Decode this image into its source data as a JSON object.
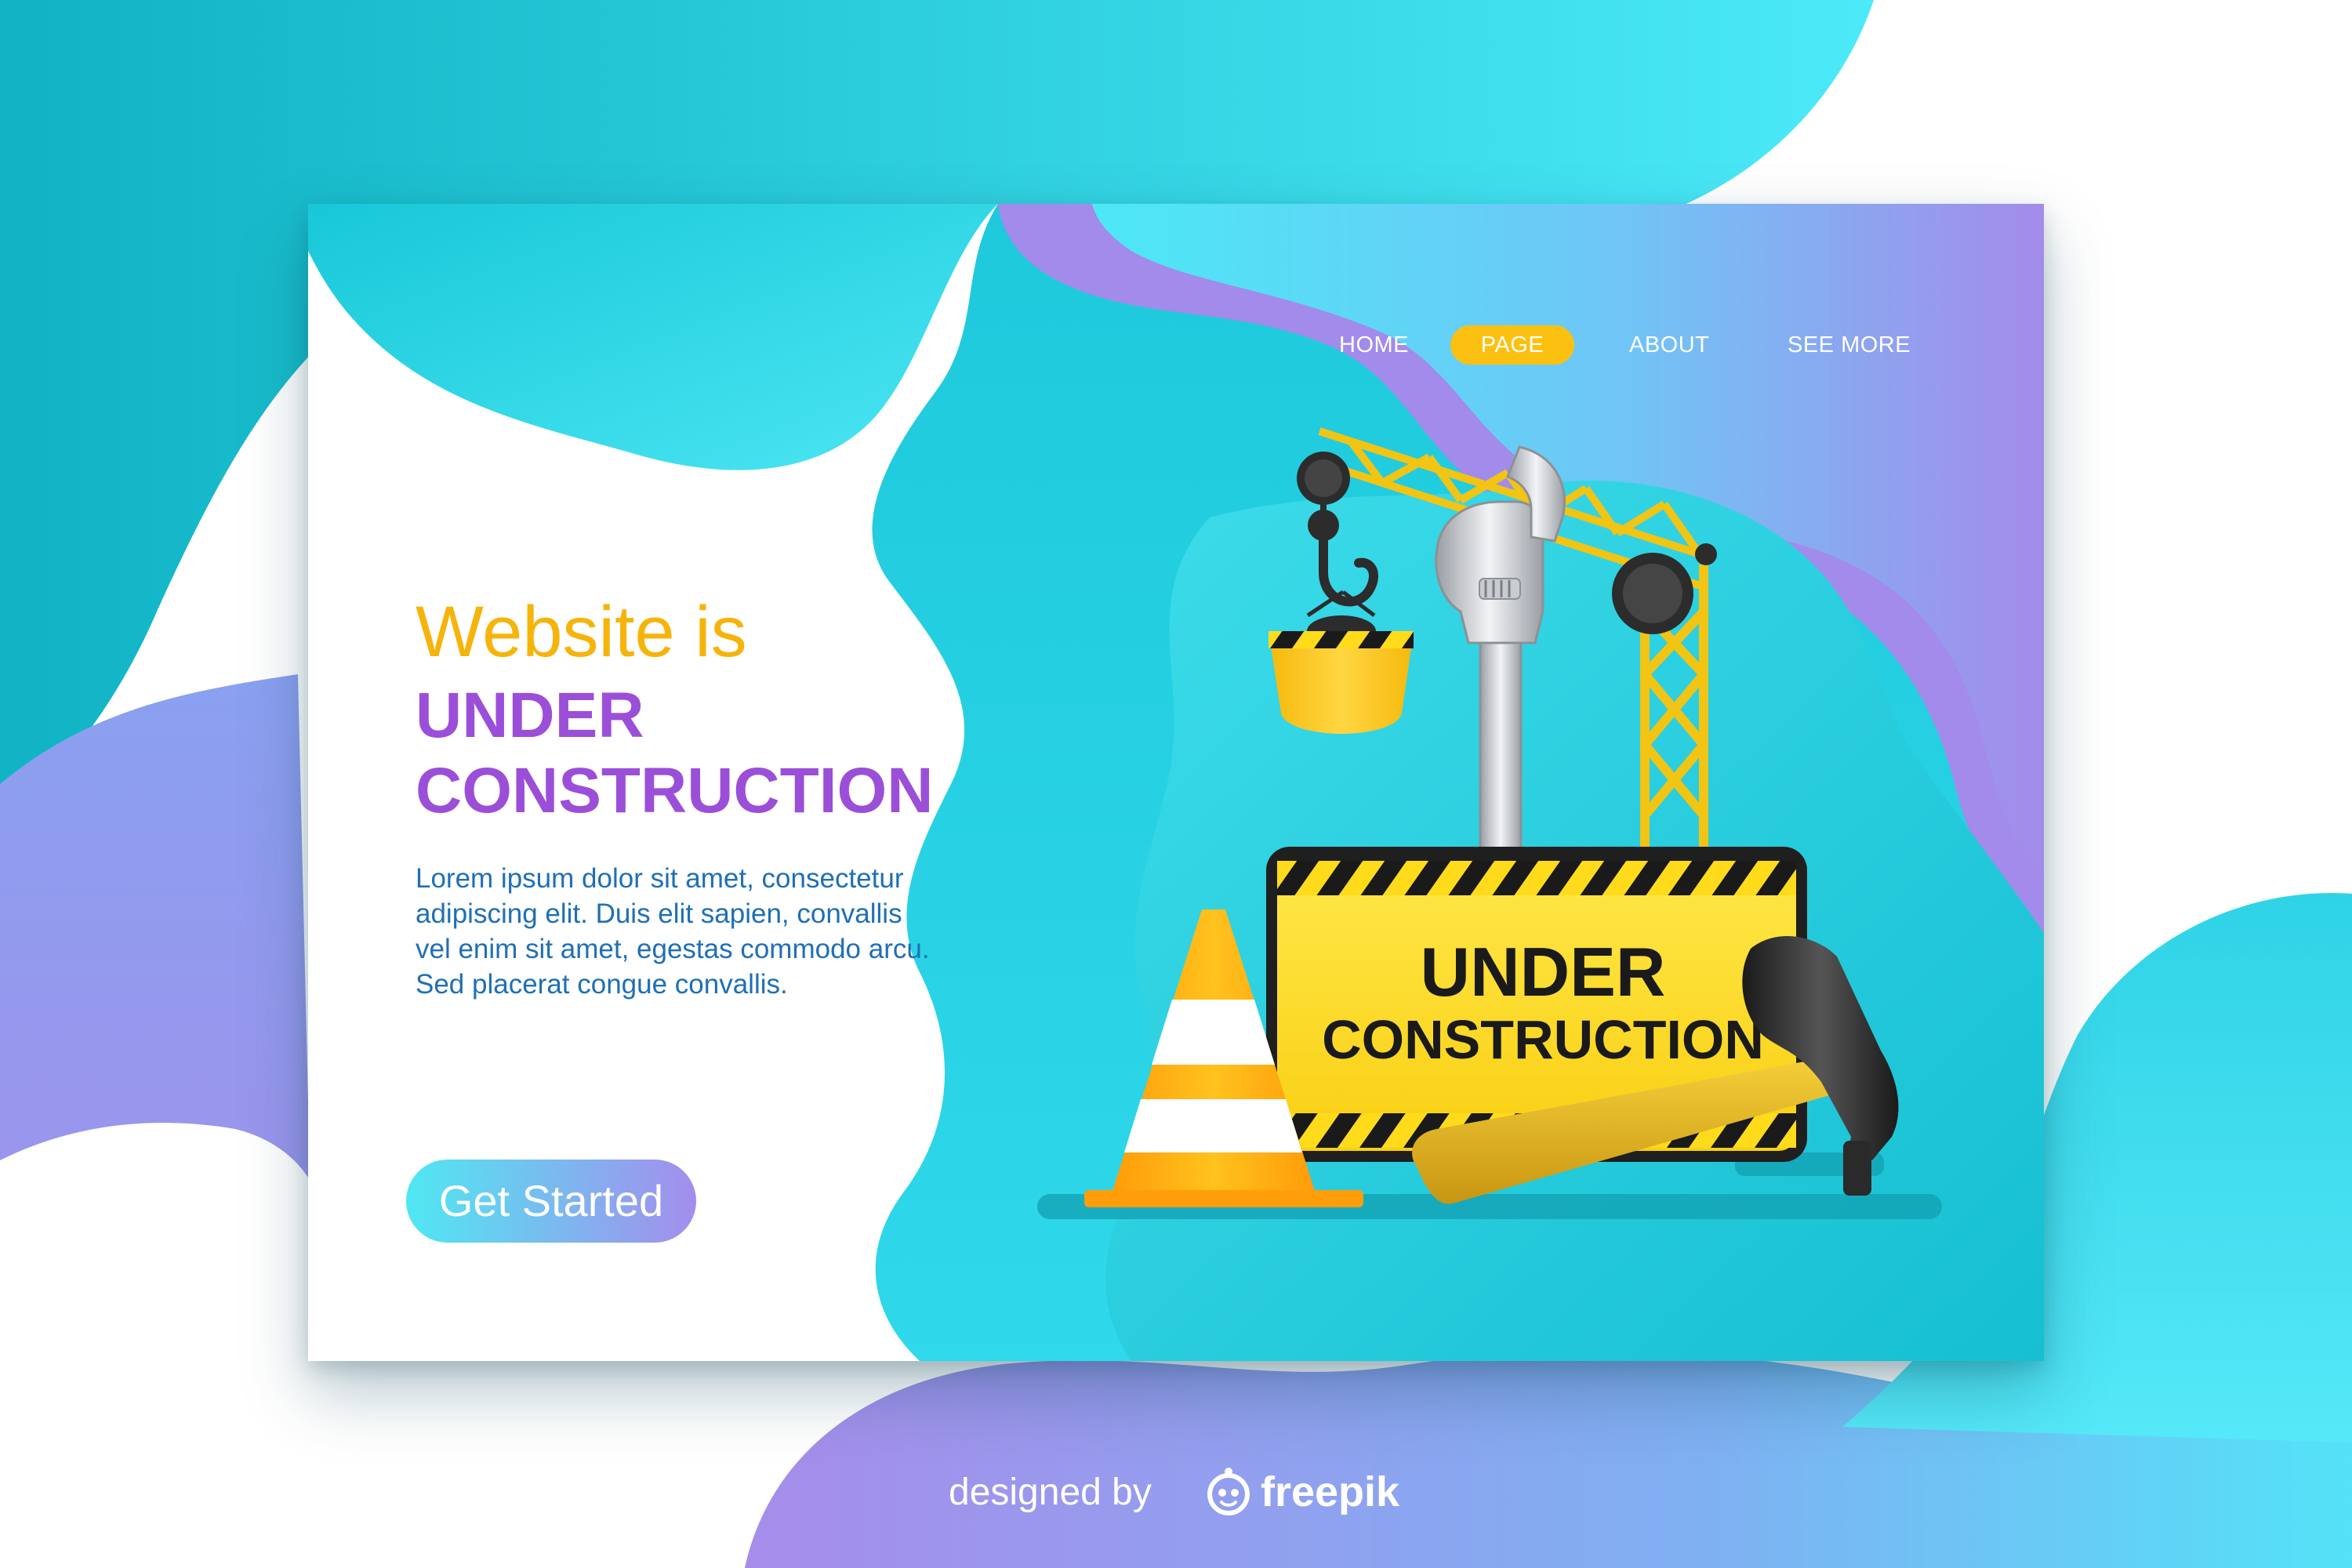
{
  "nav": {
    "items": [
      {
        "label": "HOME",
        "active": false
      },
      {
        "label": "PAGE",
        "active": true
      },
      {
        "label": "ABOUT",
        "active": false
      },
      {
        "label": "SEE MORE",
        "active": false
      }
    ]
  },
  "hero": {
    "headline_line1": "Website is",
    "headline_line2": "UNDER",
    "headline_line3": "CONSTRUCTION",
    "body_lines": [
      "Lorem ipsum dolor sit amet, consectetur",
      "adipiscing elit. Duis  elit  sapien,  convallis",
      "vel  enim  sit amet,  egestas  commodo arcu.",
      "Sed placerat congue convallis."
    ],
    "cta_label": "Get Started"
  },
  "illustration": {
    "sign_line1": "UNDER",
    "sign_line2": "CONSTRUCTION",
    "icons": [
      "crane-icon",
      "hook-icon",
      "bucket-icon",
      "wrench-icon",
      "traffic-cone-icon",
      "hammer-icon",
      "warning-sign-icon"
    ]
  },
  "footer": {
    "designed_by": "designed by",
    "brand": "freepik"
  },
  "colors": {
    "teal": "#12b8c8",
    "cyan": "#4ce8f6",
    "purple": "#a28bea",
    "yellow": "#fcc010",
    "headline_orange": "#f6b40b",
    "headline_purple": "#9b4fd8",
    "body_blue": "#1f6fb5"
  }
}
